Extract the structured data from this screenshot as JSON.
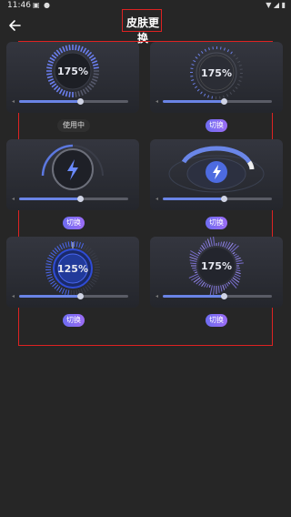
{
  "status": {
    "time": "11:46",
    "icons": [
      "image-icon",
      "notification-icon"
    ]
  },
  "header": {
    "title": "皮肤更换"
  },
  "skins": [
    {
      "label": "175%",
      "progress": 0.55,
      "action": "使用中",
      "in_use": true
    },
    {
      "label": "175%",
      "progress": 0.55,
      "action": "切换",
      "in_use": false
    },
    {
      "label": "",
      "progress": 0.55,
      "action": "切换",
      "in_use": false,
      "icon": "lightning-icon"
    },
    {
      "label": "",
      "progress": 0.55,
      "action": "切换",
      "in_use": false,
      "icon": "lightning-icon"
    },
    {
      "label": "125%",
      "progress": 0.55,
      "action": "切换",
      "in_use": false
    },
    {
      "label": "175%",
      "progress": 0.55,
      "action": "切换",
      "in_use": false
    }
  ]
}
